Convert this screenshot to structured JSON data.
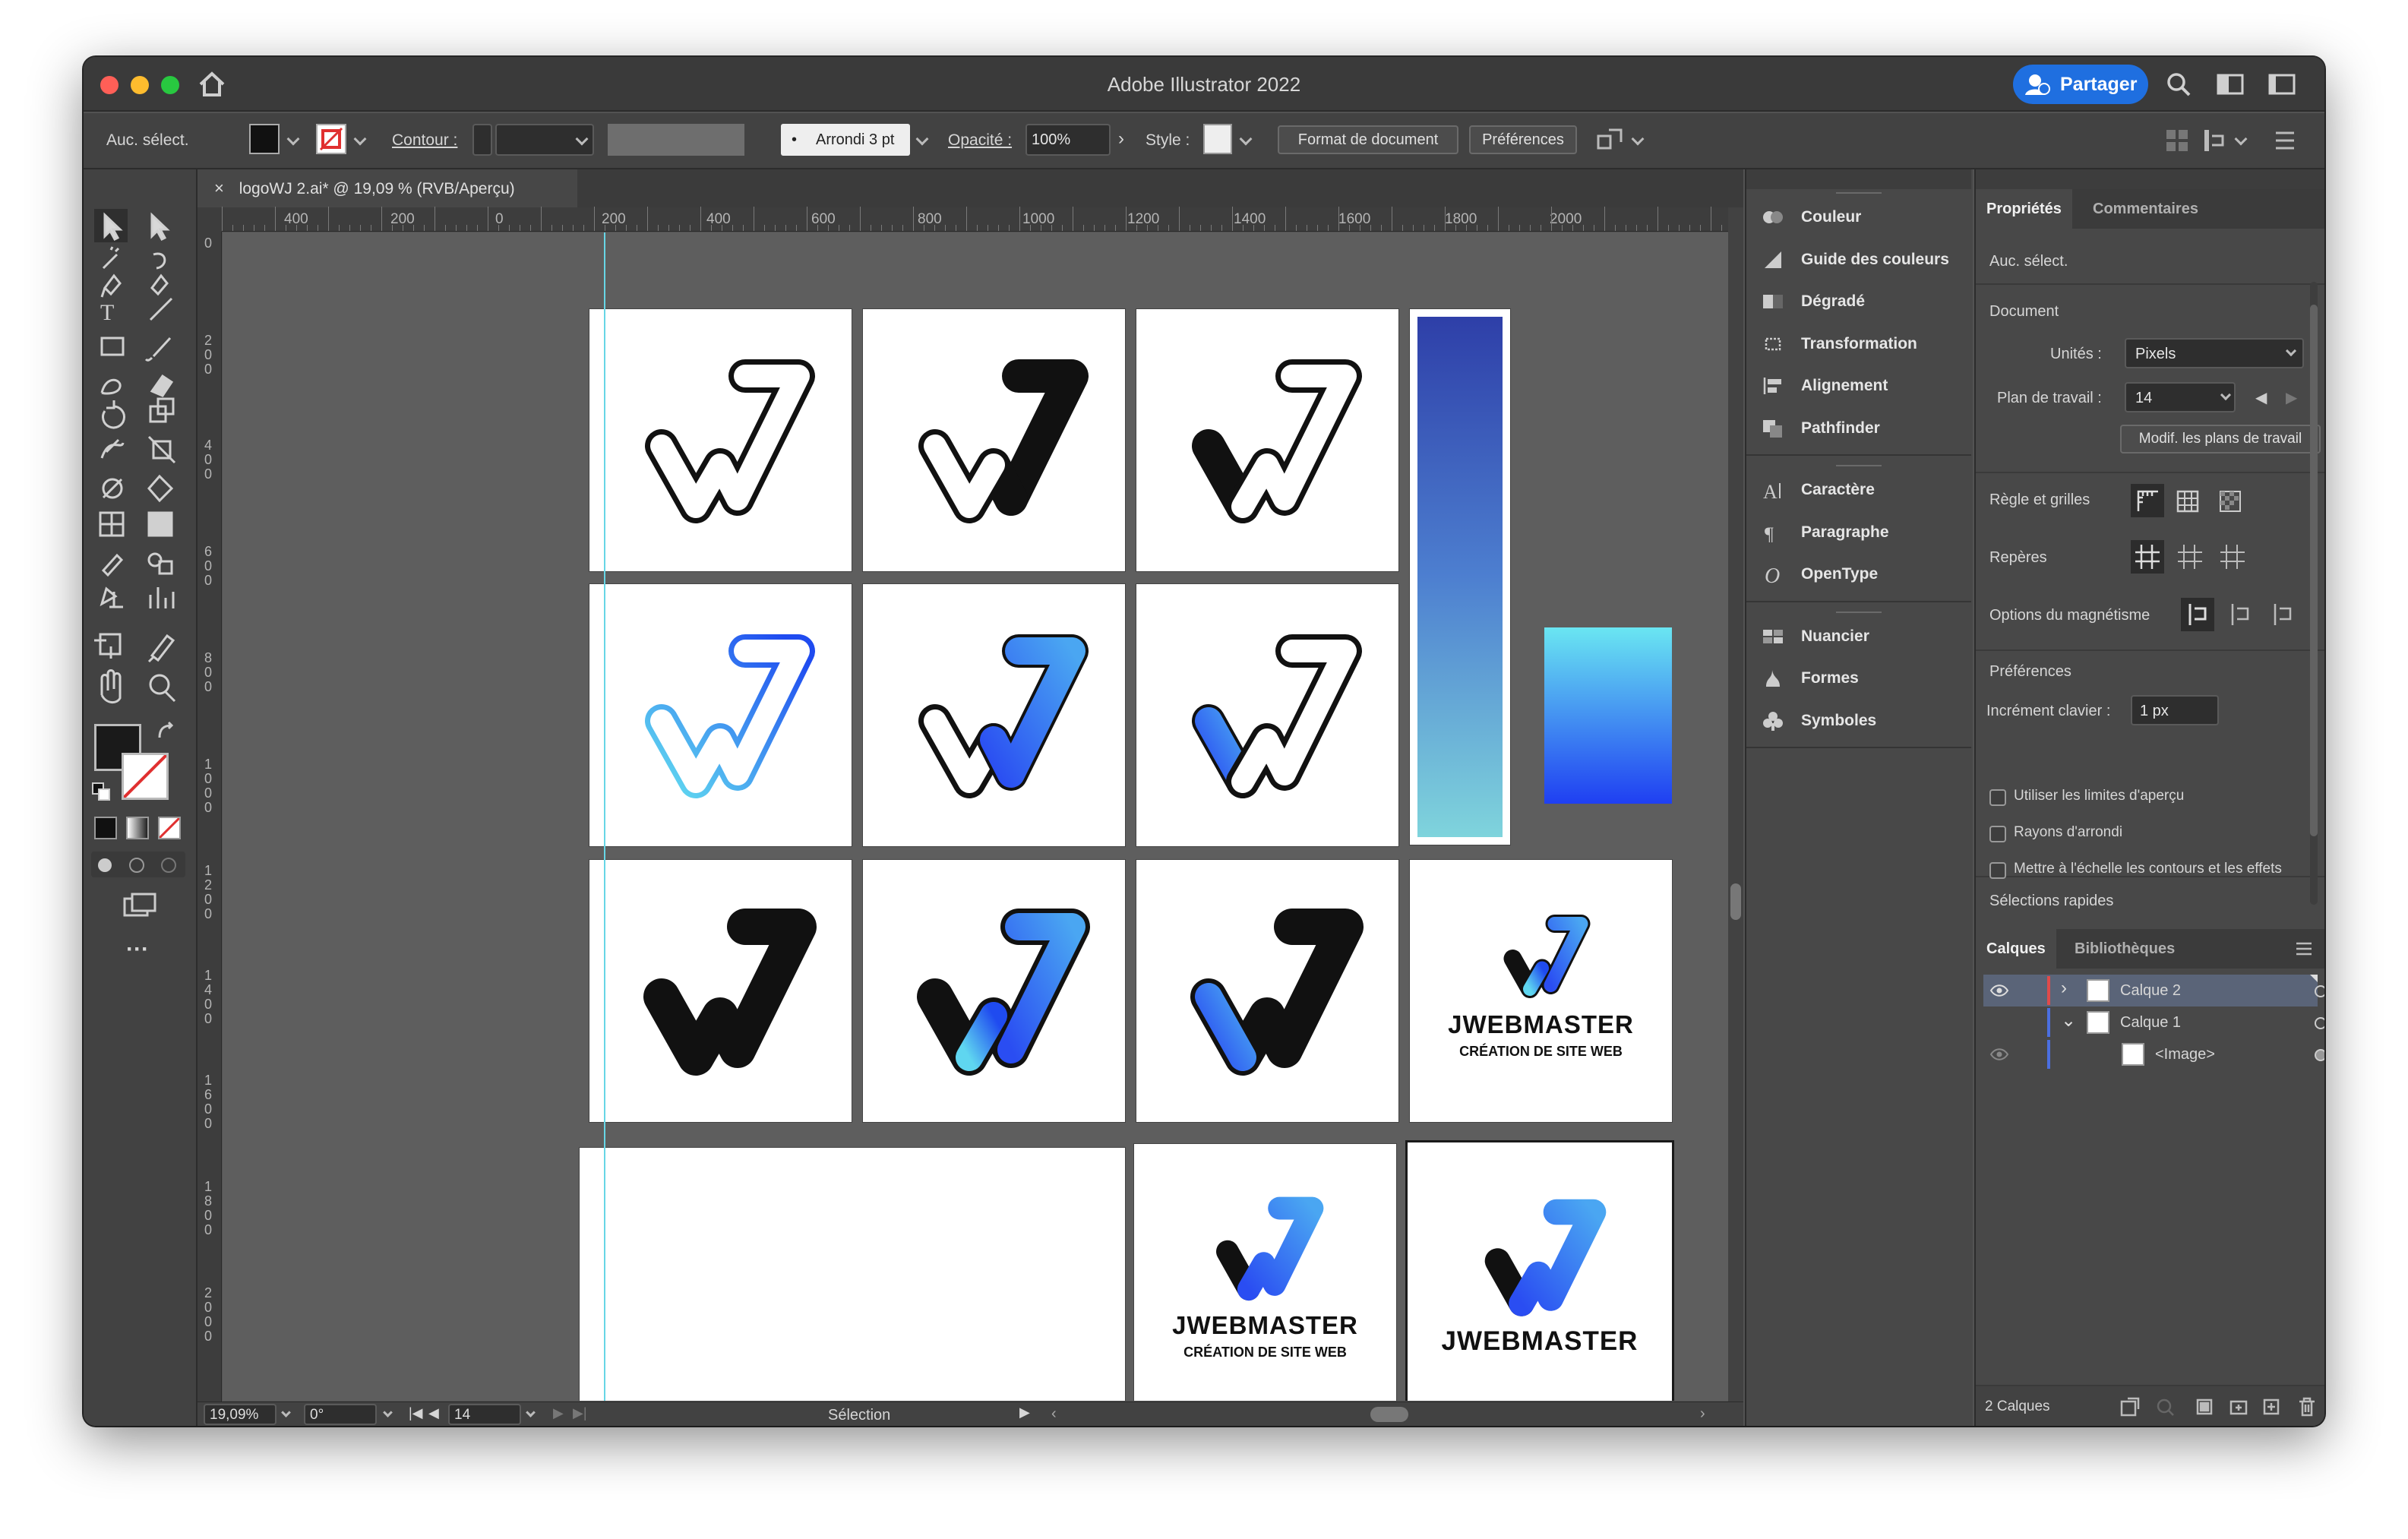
{
  "app": {
    "title": "Adobe Illustrator 2022",
    "share_label": "Partager"
  },
  "control_bar": {
    "selection": "Auc. sélect.",
    "stroke_label": "Contour :",
    "brush": "Arrondi 3 pt",
    "opacity_label": "Opacité :",
    "opacity_value": "100%",
    "style_label": "Style :",
    "doc_format_button": "Format de document",
    "preferences_button": "Préférences"
  },
  "document": {
    "tab_title": "logoWJ 2.ai* @ 19,09 % (RVB/Aperçu)",
    "ruler_h": [
      "400",
      "200",
      "0",
      "200",
      "400",
      "600",
      "800",
      "1000",
      "1200",
      "1400",
      "1600",
      "1800",
      "2000"
    ],
    "ruler_v": [
      "0",
      "200",
      "400",
      "600",
      "800",
      "1000",
      "1200",
      "1400",
      "1600",
      "1800",
      "2000"
    ]
  },
  "status_bar": {
    "zoom": "19,09%",
    "rotation": "0°",
    "artboard": "14",
    "tool": "Sélection"
  },
  "artboards": {
    "brand": "JWEBMASTER",
    "tagline": "CRÉATION DE SITE WEB"
  },
  "mid_panel": {
    "group1": [
      "Couleur",
      "Guide des couleurs",
      "Dégradé",
      "Transformation",
      "Alignement",
      "Pathfinder"
    ],
    "group2": [
      "Caractère",
      "Paragraphe",
      "OpenType"
    ],
    "group3": [
      "Nuancier",
      "Formes",
      "Symboles"
    ]
  },
  "properties": {
    "tab_properties": "Propriétés",
    "tab_comments": "Commentaires",
    "selection": "Auc. sélect.",
    "document_label": "Document",
    "units_label": "Unités :",
    "units_value": "Pixels",
    "artboard_label": "Plan de travail :",
    "artboard_value": "14",
    "edit_artboards_button": "Modif. les plans de travail",
    "rulers_grids_label": "Règle et grilles",
    "guides_label": "Repères",
    "snap_label": "Options du magnétisme",
    "preferences_label": "Préférences",
    "keyboard_increment_label": "Incrément clavier :",
    "keyboard_increment_value": "1 px",
    "checkboxes": [
      "Utiliser les limites d'aperçu",
      "Rayons d'arrondi",
      "Mettre à l'échelle les contours et les effets"
    ],
    "quick_actions_label": "Sélections rapides"
  },
  "layers": {
    "tab_layers": "Calques",
    "tab_libraries": "Bibliothèques",
    "rows": [
      "Calque 2",
      "Calque 1",
      "<Image>"
    ],
    "count": "2 Calques"
  },
  "colors": {
    "accent": "#1f6fe0",
    "panel_bg": "#484848",
    "canvas_bg": "#5e5e5e",
    "layer2_color": "#e04b4b",
    "layer1_color": "#4b6fe0"
  }
}
